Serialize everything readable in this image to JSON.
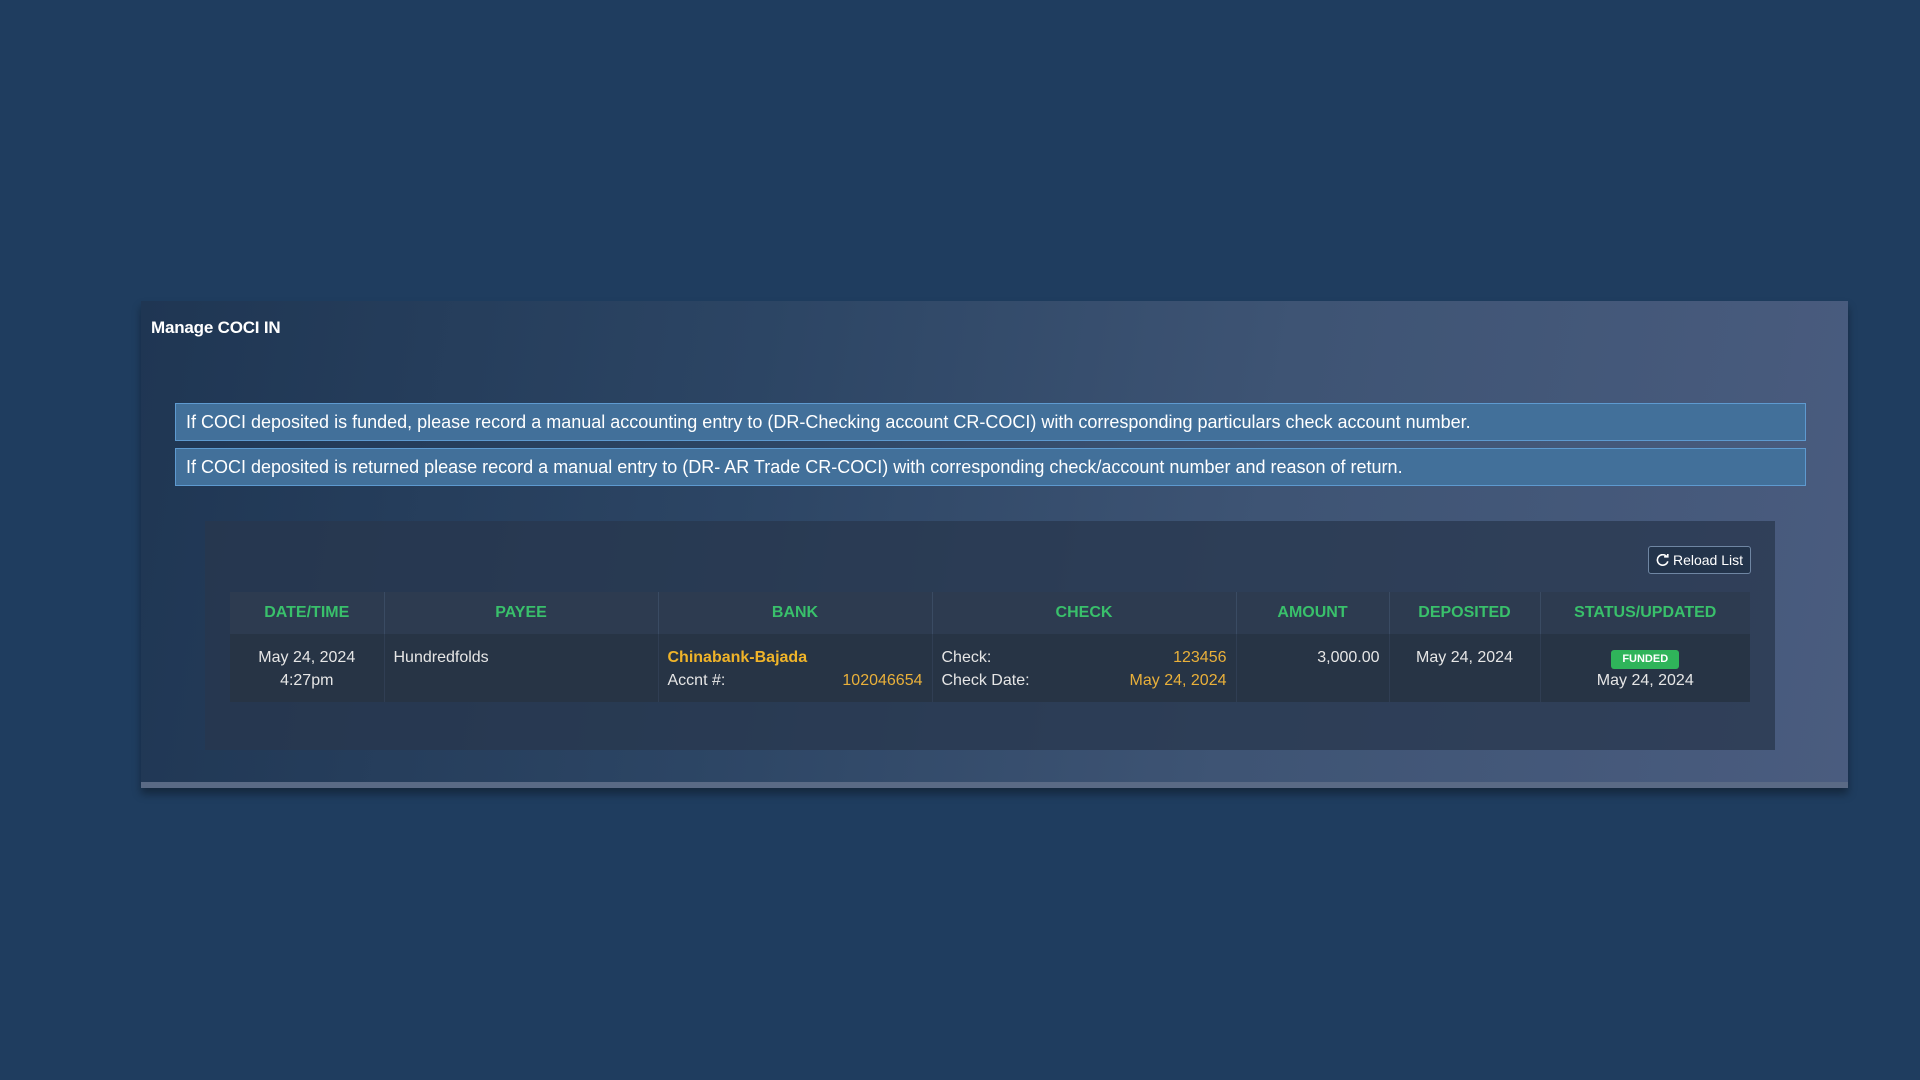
{
  "panel": {
    "title": "Manage COCI IN"
  },
  "alerts": [
    "If COCI deposited is funded, please record a manual accounting entry to (DR-Checking account CR-COCI) with corresponding particulars check account number.",
    "If COCI deposited is returned please record a manual entry to (DR- AR Trade CR-COCI) with corresponding check/account number and reason of return."
  ],
  "toolbar": {
    "reload_label": "Reload List",
    "reload_icon": "refresh-icon"
  },
  "table": {
    "columns": [
      "DATE/TIME",
      "PAYEE",
      "BANK",
      "CHECK",
      "AMOUNT",
      "DEPOSITED",
      "STATUS/UPDATED"
    ],
    "rows": [
      {
        "date": "May 24, 2024",
        "time": "4:27pm",
        "payee": "Hundredfolds",
        "bank_name": "Chinabank-Bajada",
        "accnt_label": "Accnt #:",
        "accnt_value": "102046654",
        "check_label": "Check:",
        "check_value": "123456",
        "check_date_label": "Check Date:",
        "check_date_value": "May 24, 2024",
        "amount": "3,000.00",
        "deposited": "May 24, 2024",
        "status": "FUNDED",
        "updated": "May 24, 2024"
      }
    ]
  },
  "colors": {
    "background": "#1f3d5f",
    "header_text": "#39c06b",
    "gold": "#e9b03a",
    "badge_funded": "#2fb45a",
    "alert_bg": "#42709a"
  }
}
